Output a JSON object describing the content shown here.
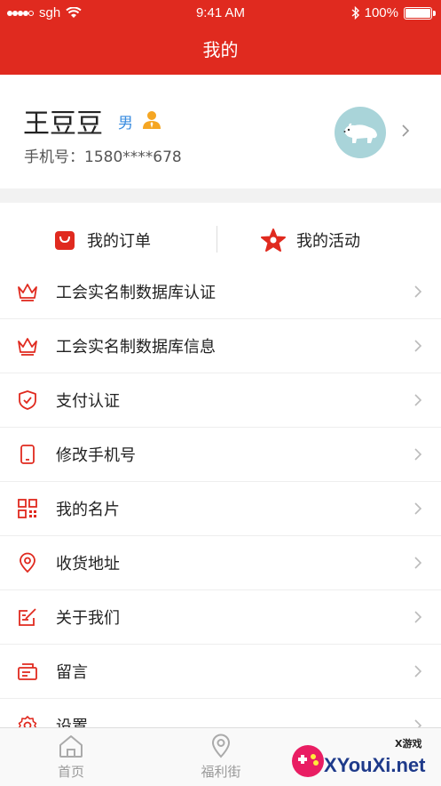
{
  "status_bar": {
    "carrier": "sgh",
    "time": "9:41 AM",
    "battery": "100%",
    "battery_level": 1.0
  },
  "nav": {
    "title": "我的"
  },
  "profile": {
    "name": "王豆豆",
    "gender": "男",
    "phone": "手机号：1580****678"
  },
  "tabs": [
    {
      "label": "我的订单",
      "icon": "shopping-bag-icon"
    },
    {
      "label": "我的活动",
      "icon": "star-icon"
    }
  ],
  "menu": [
    {
      "label": "工会实名制数据库认证",
      "icon": "crown-icon"
    },
    {
      "label": "工会实名制数据库信息",
      "icon": "crown-icon"
    },
    {
      "label": "支付认证",
      "icon": "shield-check-icon"
    },
    {
      "label": "修改手机号",
      "icon": "phone-icon"
    },
    {
      "label": "我的名片",
      "icon": "qrcode-icon"
    },
    {
      "label": "收货地址",
      "icon": "location-pin-icon"
    },
    {
      "label": "关于我们",
      "icon": "edit-note-icon"
    },
    {
      "label": "留言",
      "icon": "message-icon"
    },
    {
      "label": "设置",
      "icon": "gear-icon"
    }
  ],
  "tabbar": [
    {
      "label": "首页",
      "icon": "home-icon"
    },
    {
      "label": "福利街",
      "icon": "location-pin-icon"
    }
  ],
  "watermark": {
    "text": "XYouXi.net",
    "small": "X游戏"
  },
  "colors": {
    "brand": "#e02a1f",
    "accent_blue": "#3a8de0",
    "person_orange": "#f5a623"
  }
}
